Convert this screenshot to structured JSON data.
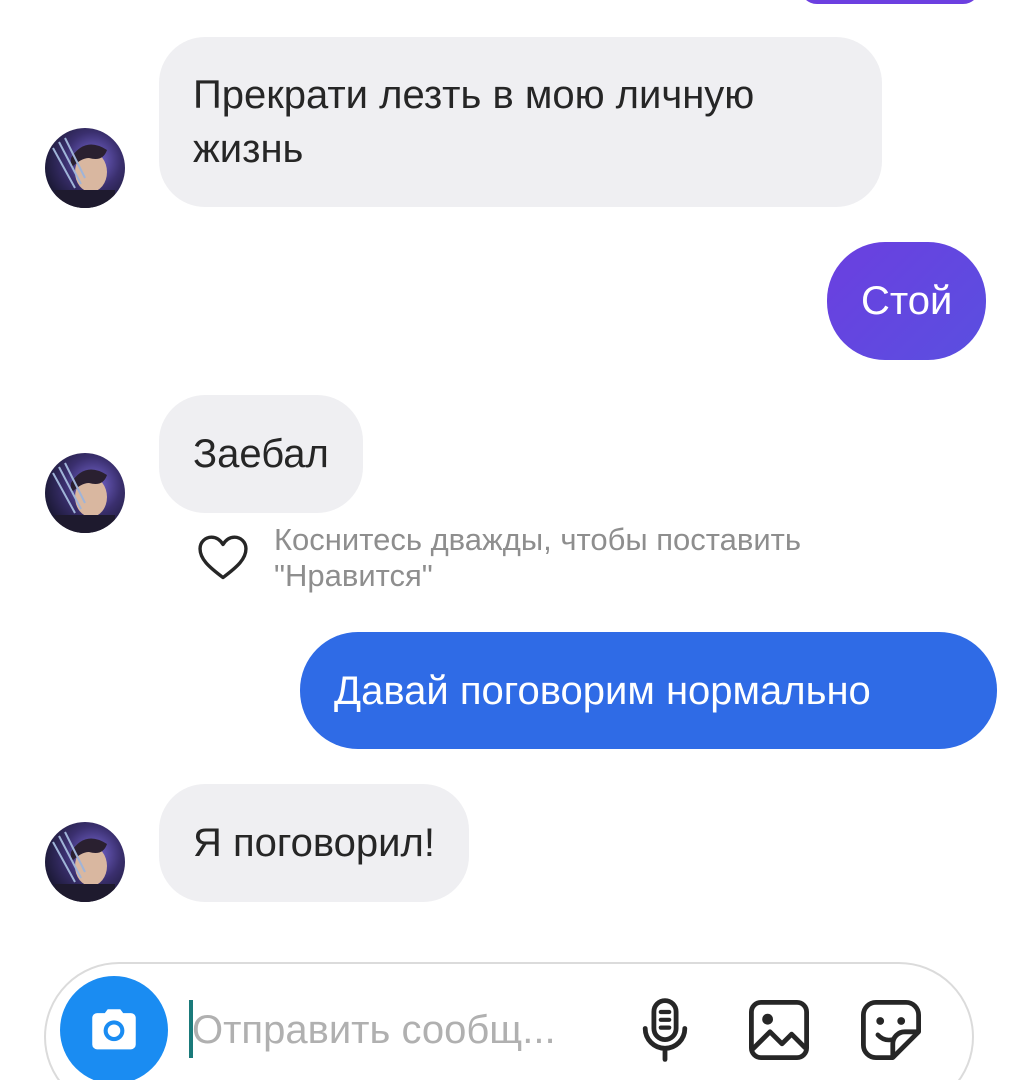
{
  "colors": {
    "incoming_bubble": "#efeff2",
    "outgoing_purple": "#6b3fe0",
    "outgoing_blue": "#2f6be6",
    "accent_camera": "#1a8cf2",
    "hint_text": "#8e8e8e",
    "placeholder": "#b0b0b0"
  },
  "messages": [
    {
      "direction": "incoming",
      "text": "Прекрати лезть в мою личную жизнь",
      "avatar": "contact-avatar"
    },
    {
      "direction": "outgoing",
      "text": "Стой"
    },
    {
      "direction": "incoming",
      "text": "Заебал",
      "avatar": "contact-avatar"
    },
    {
      "direction": "outgoing",
      "text": "Давай поговорим нормально"
    },
    {
      "direction": "incoming",
      "text": "Я поговорил!",
      "avatar": "contact-avatar"
    }
  ],
  "like_hint": {
    "icon": "heart-outline-icon",
    "text": "Коснитесь дважды, чтобы поставить \"Нравится\""
  },
  "composer": {
    "placeholder": "Отправить сообщ...",
    "icons": [
      "camera-icon",
      "microphone-icon",
      "gallery-icon",
      "sticker-icon"
    ]
  }
}
